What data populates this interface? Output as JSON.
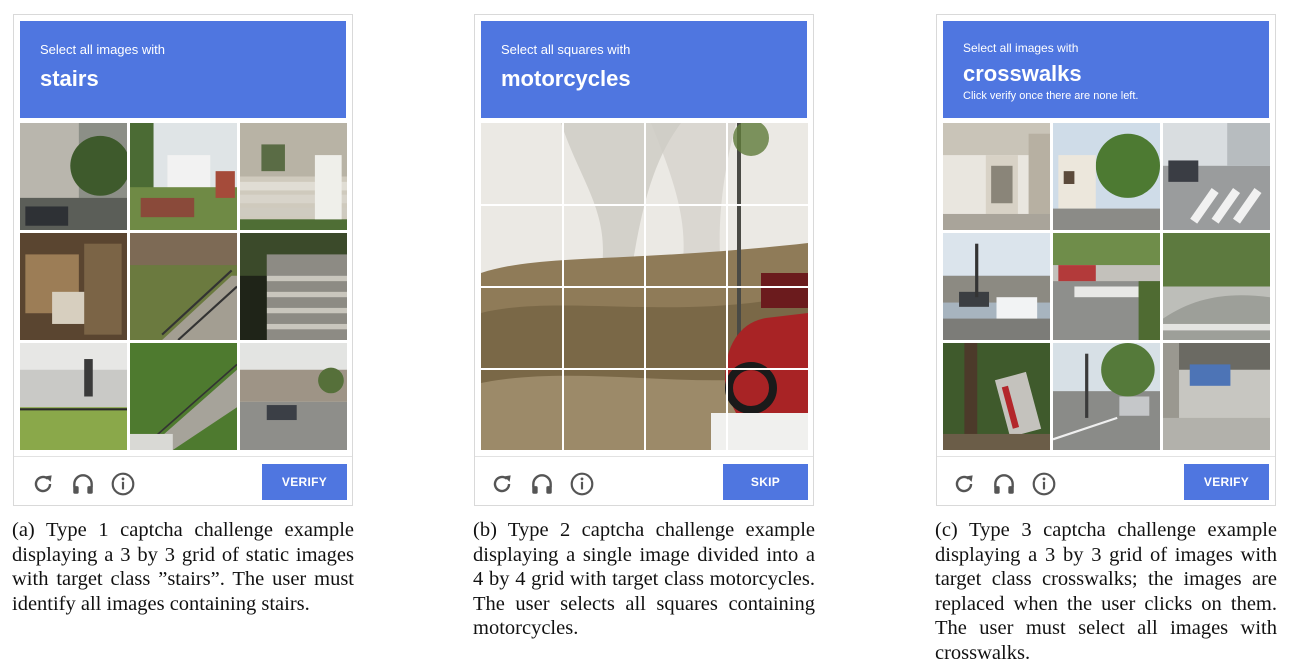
{
  "panels": [
    {
      "prompt": "Select all images with",
      "target": "stairs",
      "note": "",
      "button": "VERIFY",
      "caption": "(a) Type 1 captcha challenge example displaying a 3 by 3 grid of static images with target class ”stairs”. The user must identify all images containing stairs."
    },
    {
      "prompt": "Select all squares with",
      "target": "motorcycles",
      "note": "",
      "button": "SKIP",
      "caption": "(b) Type 2 captcha challenge example displaying a single image divided into a 4 by 4 grid with target class motorcycles. The user selects all squares containing motorcycles."
    },
    {
      "prompt": "Select all images with",
      "target": "crosswalks",
      "note": "Click verify once there are none left.",
      "button": "VERIFY",
      "caption": "(c) Type 3 captcha challenge example displaying a 3 by 3 grid of images with target class crosswalks; the images are replaced when the user clicks on them. The user must select all images with crosswalks."
    }
  ],
  "icons": [
    "reload-icon",
    "audio-icon",
    "info-icon"
  ],
  "colors": {
    "accent": "#4f76e0"
  }
}
